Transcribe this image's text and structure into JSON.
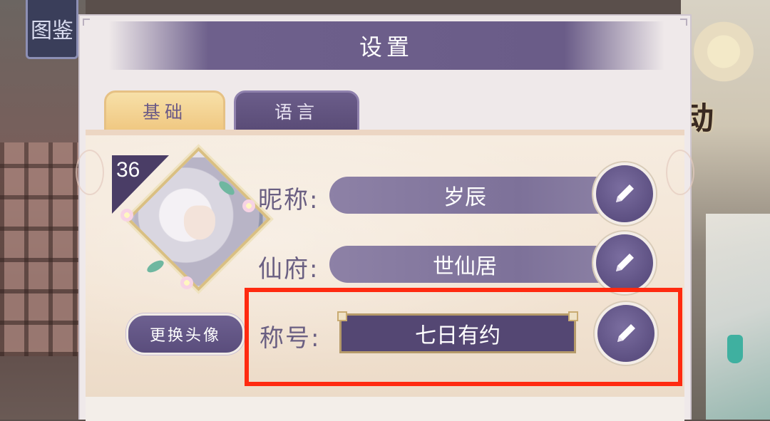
{
  "background": {
    "badge_text": "图鉴",
    "right_text": "动"
  },
  "panel": {
    "title": "设置",
    "tabs": [
      {
        "label": "基础",
        "active": true
      },
      {
        "label": "语言",
        "active": false
      }
    ]
  },
  "profile": {
    "level": "36",
    "change_avatar_label": "更换头像",
    "rows": [
      {
        "label": "昵称:",
        "value": "岁辰",
        "highlighted": false
      },
      {
        "label": "仙府:",
        "value": "世仙居",
        "highlighted": false
      },
      {
        "label": "称号:",
        "value": "七日有约",
        "highlighted": true
      }
    ],
    "edit_icon": "pencil-icon"
  },
  "colors": {
    "accent_purple": "#5d5082",
    "tab_active": "#f0c882",
    "highlight": "#ff2a10"
  }
}
